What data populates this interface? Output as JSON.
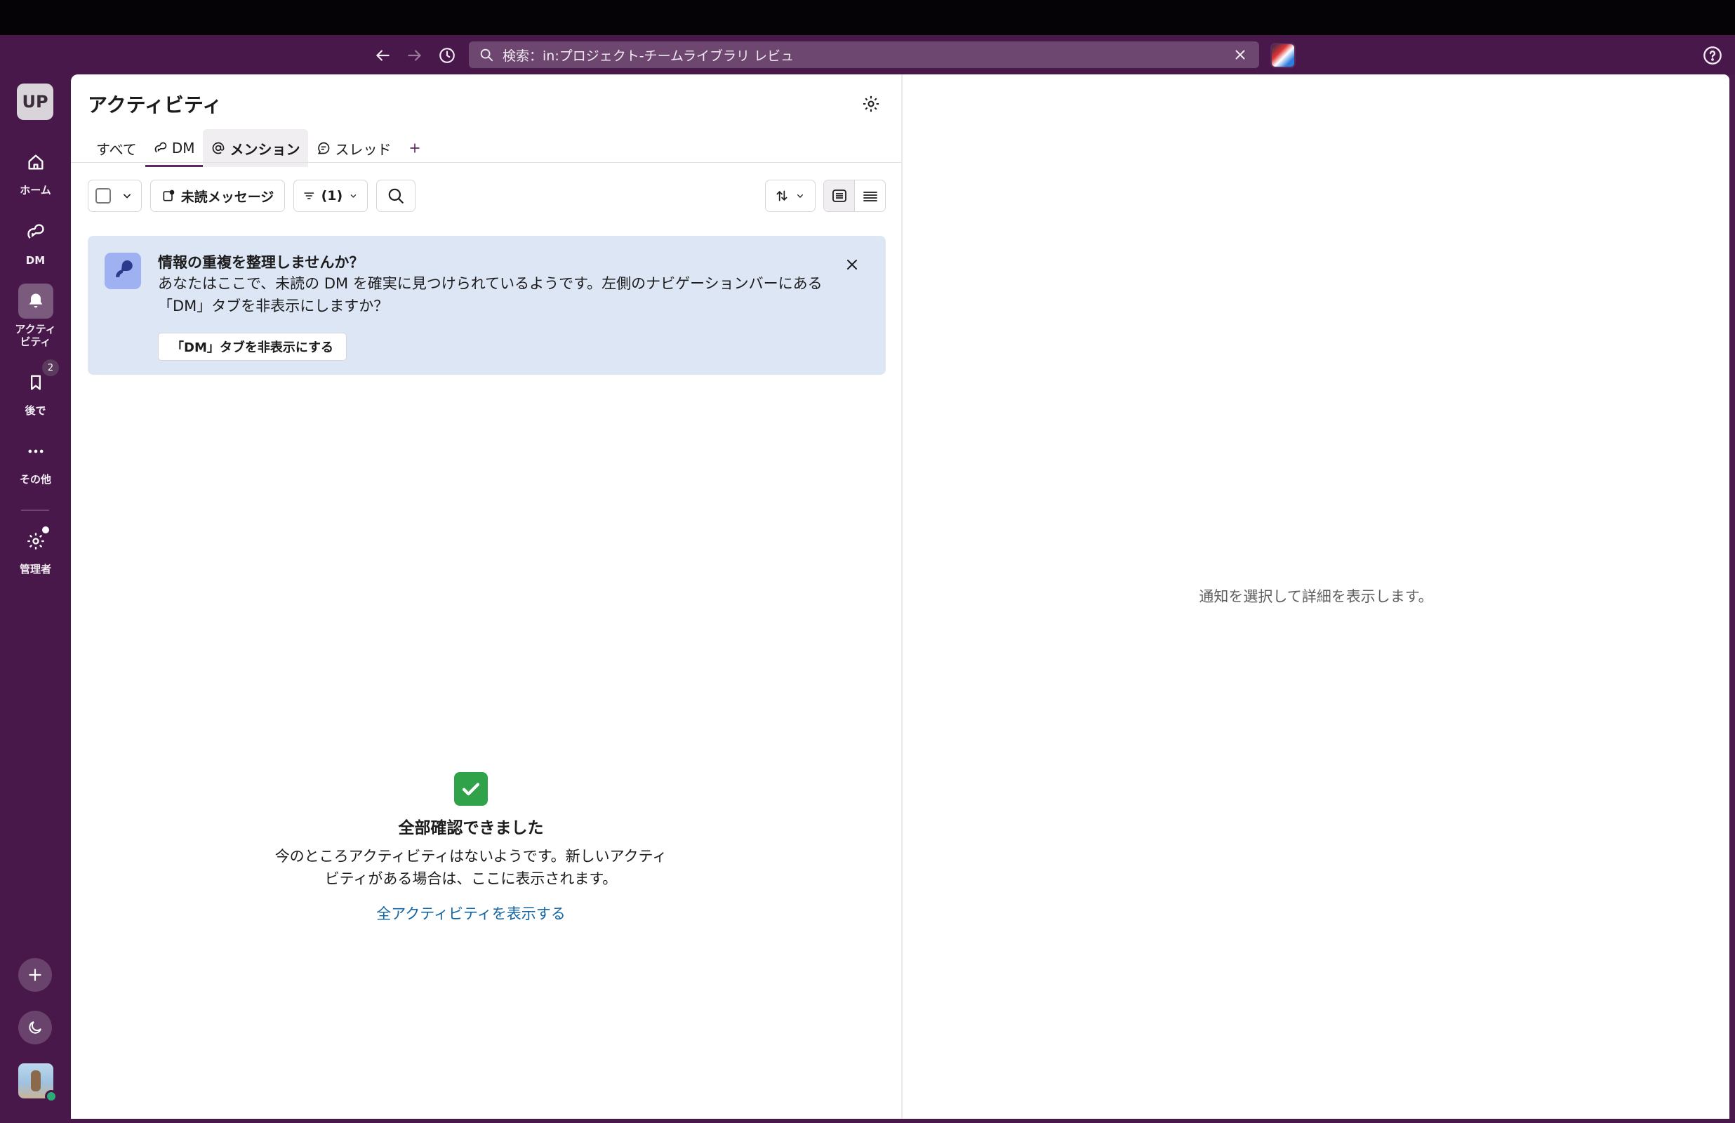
{
  "titlebar": {
    "search": {
      "text": "検索：in:プロジェクト-チームライブラリ レビュ"
    }
  },
  "sidebar": {
    "workspace_initials": "UP",
    "items": [
      {
        "label": "ホーム",
        "icon": "home-icon"
      },
      {
        "label": "DM",
        "icon": "dm-icon"
      },
      {
        "label": "アクティビティ",
        "icon": "bell-icon"
      },
      {
        "label": "後で",
        "icon": "bookmark-icon",
        "badge": "2"
      },
      {
        "label": "その他",
        "icon": "more-icon"
      },
      {
        "label": "管理者",
        "icon": "gear-icon"
      }
    ]
  },
  "main": {
    "title": "アクティビティ",
    "tabs": [
      {
        "label": "すべて"
      },
      {
        "label": "DM"
      },
      {
        "label": "メンション"
      },
      {
        "label": "スレッド"
      }
    ],
    "toolbar": {
      "unread_label": "未読メッセージ",
      "filter_label": "(1)"
    },
    "banner": {
      "title": "情報の重複を整理しませんか？",
      "body": "あなたはここで、未読の DM を確実に見つけられているようです。左側のナビゲーションバーにある「DM」タブを非表示にしますか？",
      "action": "「DM」タブを非表示にする"
    },
    "empty_state": {
      "title": "全部確認できました",
      "description": "今のところアクティビティはないようです。新しいアクティビティがある場合は、ここに表示されます。",
      "link": "全アクティビティを表示する"
    }
  },
  "detail": {
    "hint": "通知を選択して詳細を表示します。"
  },
  "colors": {
    "aubergine": "#48184b",
    "accent": "#5b2c5f",
    "banner_bg": "#dde6f5",
    "link": "#1264a3"
  }
}
